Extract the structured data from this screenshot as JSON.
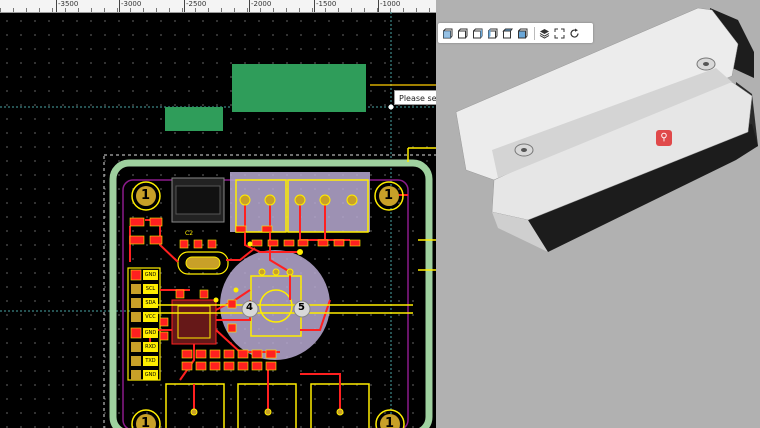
{
  "ruler": {
    "ticks": [
      "-3500",
      "-3000",
      "-2500",
      "-2000",
      "-1500",
      "-1000"
    ]
  },
  "canvas": {
    "prompt_text": "Please sele"
  },
  "pcb": {
    "mount_hole_labels": [
      "1",
      "1",
      "1",
      "1"
    ],
    "pin_labels": [
      "4",
      "5"
    ],
    "header_labels": [
      "GND",
      "SCL",
      "SDA",
      "VCC",
      "GND",
      "RXD",
      "TXD",
      "GND"
    ],
    "component_labels": [
      "C2"
    ],
    "colors": {
      "board_outline": "#9fd19f",
      "top_copper": "#ff2020",
      "silkscreen": "#ffee00",
      "board_edge": "#8b1b8b",
      "keepout": "#b9aad2",
      "pad": "#c8a028"
    }
  },
  "view3d": {
    "toolbar": {
      "buttons": [
        "view-front-icon",
        "view-back-icon",
        "view-left-icon",
        "view-right-icon",
        "view-top-icon",
        "view-bottom-icon",
        "layers-icon",
        "fullscreen-icon",
        "rotate-icon"
      ]
    },
    "background_color": "#b1b1b1",
    "model_color": "#ececec"
  }
}
